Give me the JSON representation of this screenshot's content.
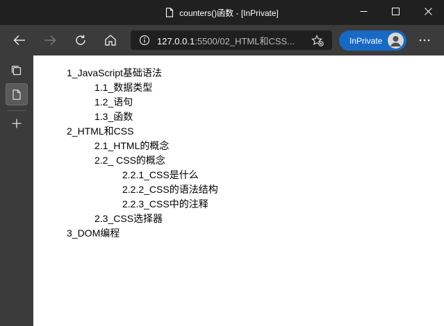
{
  "window": {
    "title": "counters()函数 - [InPrivate]"
  },
  "addressbar": {
    "url_host": "127.0.0.1",
    "url_rest": ":5500/02_HTML和CSS...",
    "inprivate_label": "InPrivate"
  },
  "page": {
    "outline": [
      {
        "text": "1_JavaScript基础语法",
        "level": 1
      },
      {
        "text": "1.1_数据类型",
        "level": 2
      },
      {
        "text": "1.2_语句",
        "level": 2
      },
      {
        "text": "1.3_函数",
        "level": 2
      },
      {
        "text": "2_HTML和CSS",
        "level": 1
      },
      {
        "text": "2.1_HTML的概念",
        "level": 2
      },
      {
        "text": "2.2_ CSS的概念",
        "level": 2
      },
      {
        "text": "2.2.1_CSS是什么",
        "level": 3
      },
      {
        "text": "2.2.2_CSS的语法结构",
        "level": 3
      },
      {
        "text": "2.2.3_CSS中的注释",
        "level": 3
      },
      {
        "text": "2.3_CSS选择器",
        "level": 2
      },
      {
        "text": "3_DOM编程",
        "level": 1
      }
    ]
  },
  "colors": {
    "frame": "#202020",
    "toolbar": "#3b3b3b",
    "inprivate_accent": "#1769c4",
    "page_bg": "#ffffff"
  }
}
